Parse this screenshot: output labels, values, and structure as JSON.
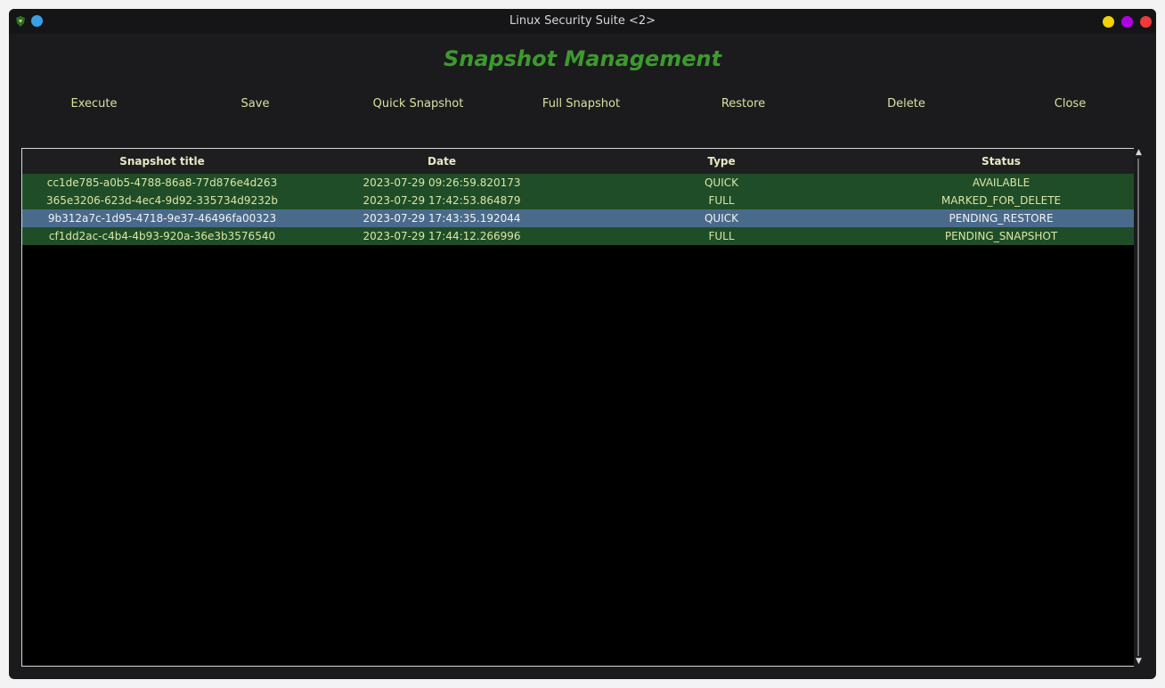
{
  "window": {
    "title": "Linux Security Suite <2>",
    "accent": "#3d9a2e"
  },
  "heading": "Snapshot Management",
  "toolbar": {
    "buttons": [
      "Execute",
      "Save",
      "Quick Snapshot",
      "Full Snapshot",
      "Restore",
      "Delete",
      "Close"
    ]
  },
  "table": {
    "columns": [
      "Snapshot title",
      "Date",
      "Type",
      "Status"
    ],
    "rows": [
      {
        "title": "cc1de785-a0b5-4788-86a8-77d876e4d263",
        "date": "2023-07-29 09:26:59.820173",
        "type": "QUICK",
        "status": "AVAILABLE",
        "selected": false
      },
      {
        "title": "365e3206-623d-4ec4-9d92-335734d9232b",
        "date": "2023-07-29 17:42:53.864879",
        "type": "FULL",
        "status": "MARKED_FOR_DELETE",
        "selected": false
      },
      {
        "title": "9b312a7c-1d95-4718-9e37-46496fa00323",
        "date": "2023-07-29 17:43:35.192044",
        "type": "QUICK",
        "status": "PENDING_RESTORE",
        "selected": true
      },
      {
        "title": "cf1dd2ac-c4b4-4b93-920a-36e3b3576540",
        "date": "2023-07-29 17:44:12.266996",
        "type": "FULL",
        "status": "PENDING_SNAPSHOT",
        "selected": false
      }
    ],
    "row_color": "#1f4d27",
    "selected_row_color": "#4a6a8c"
  },
  "icons": {
    "app": "app-shield-icon",
    "pin": "pin-dot-icon",
    "minimize": "minimize-icon",
    "maximize": "maximize-icon",
    "close": "close-icon",
    "scroll_up": "scroll-up-arrow-icon",
    "scroll_down": "scroll-down-arrow-icon"
  }
}
